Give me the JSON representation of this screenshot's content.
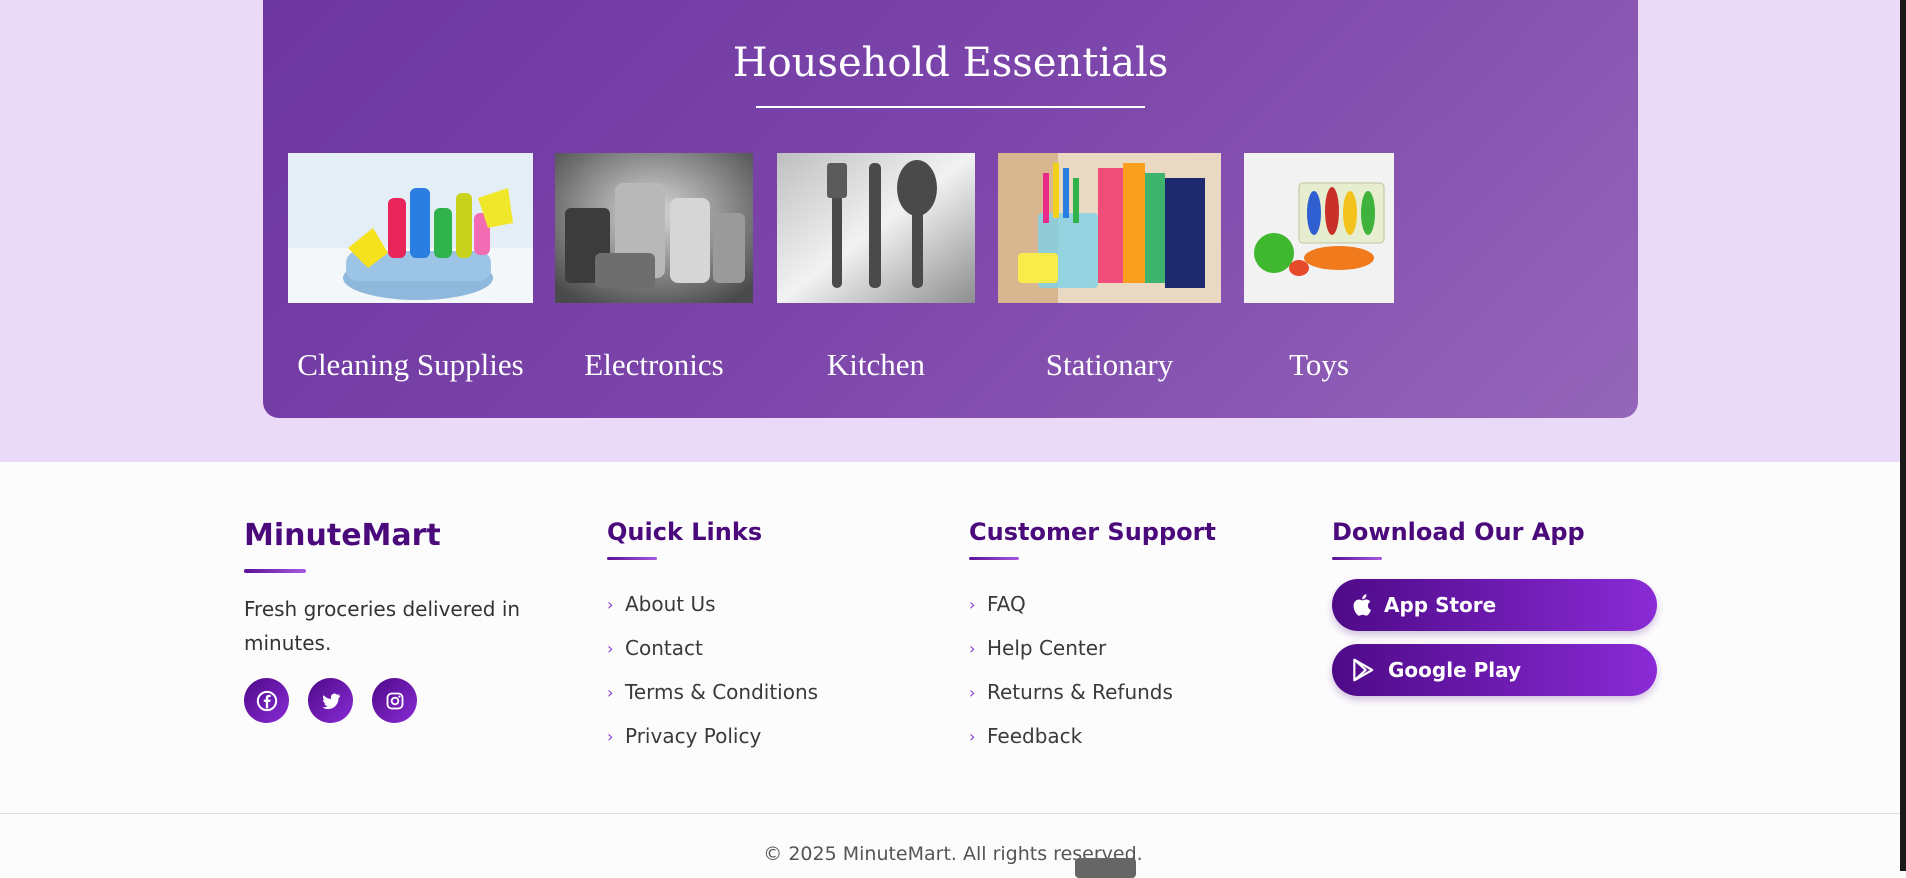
{
  "household": {
    "title": "Household Essentials",
    "categories": [
      {
        "label": "Cleaning Supplies"
      },
      {
        "label": "Electronics"
      },
      {
        "label": "Kitchen"
      },
      {
        "label": "Stationary"
      },
      {
        "label": "Toys"
      }
    ]
  },
  "footer": {
    "brand": {
      "name": "MinuteMart",
      "description": "Fresh groceries delivered in minutes.",
      "social": [
        "facebook-icon",
        "twitter-icon",
        "instagram-icon"
      ]
    },
    "quick_links": {
      "title": "Quick Links",
      "items": [
        "About Us",
        "Contact",
        "Terms & Conditions",
        "Privacy Policy"
      ]
    },
    "support": {
      "title": "Customer Support",
      "items": [
        "FAQ",
        "Help Center",
        "Returns & Refunds",
        "Feedback"
      ]
    },
    "app": {
      "title": "Download Our App",
      "app_store": "App Store",
      "google_play": "Google Play"
    },
    "copyright": "© 2025 MinuteMart. All rights reserved."
  },
  "colors": {
    "accent": "#4b0a7c",
    "band": "#ead9f7",
    "card": "#7d46ab"
  }
}
